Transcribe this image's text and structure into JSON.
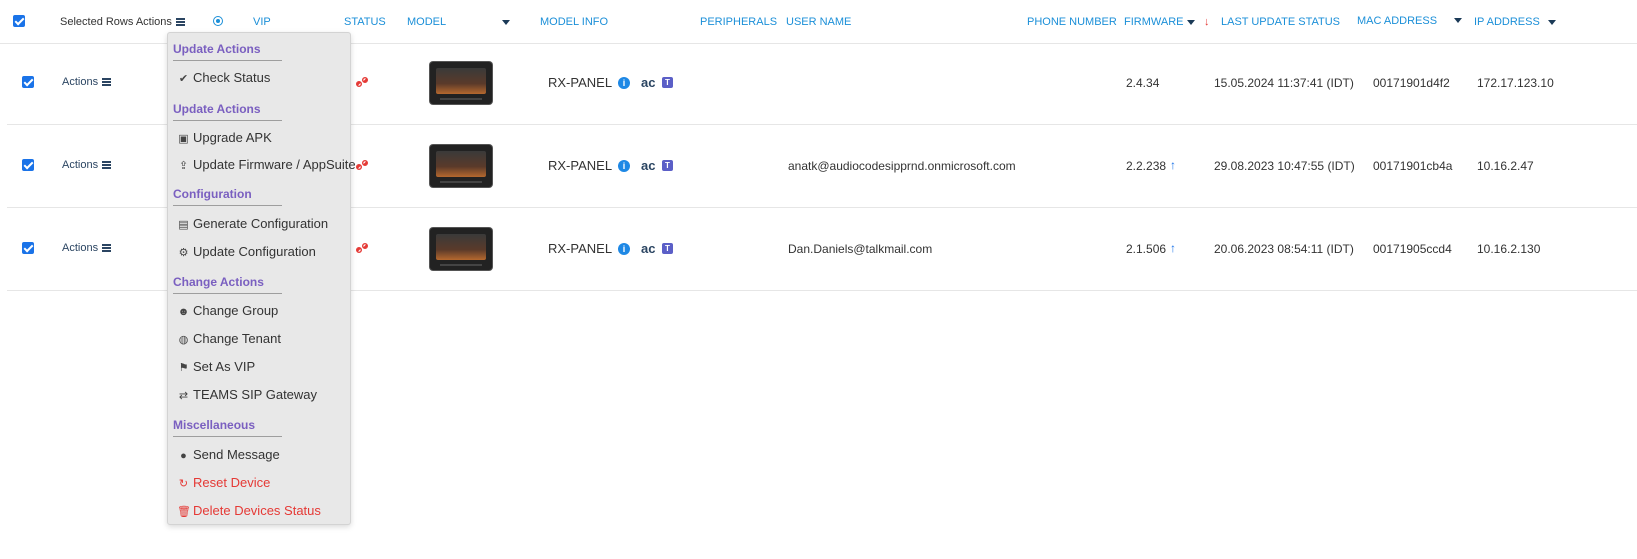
{
  "header": {
    "selected_rows_actions": "Selected Rows Actions",
    "vip": "VIP",
    "status": "STATUS",
    "model": "MODEL",
    "model_info": "MODEL INFO",
    "peripherals": "PERIPHERALS",
    "user_name": "USER NAME",
    "phone_number": "PHONE NUMBER",
    "firmware": "FIRMWARE",
    "last_update_status": "LAST UPDATE STATUS",
    "mac_address": "MAC ADDRESS",
    "ip_address": "IP ADDRESS",
    "sort_indicator": "↓"
  },
  "rows": [
    {
      "actions": "Actions",
      "model_info": "RX-PANEL",
      "user_name": "",
      "firmware": "2.4.34",
      "firmware_upgrade": false,
      "last_update": "15.05.2024 11:37:41 (IDT)",
      "mac": "00171901d4f2",
      "ip": "172.17.123.10"
    },
    {
      "actions": "Actions",
      "model_info": "RX-PANEL",
      "user_name": "anatk@audiocodesipprnd.onmicrosoft.com",
      "firmware": "2.2.238",
      "firmware_upgrade": true,
      "last_update": "29.08.2023 10:47:55 (IDT)",
      "mac": "00171901cb4a",
      "ip": "10.16.2.47"
    },
    {
      "actions": "Actions",
      "model_info": "RX-PANEL",
      "user_name": "Dan.Daniels@talkmail.com",
      "firmware": "2.1.506",
      "firmware_upgrade": true,
      "last_update": "20.06.2023 08:54:11 (IDT)",
      "mac": "00171905ccd4",
      "ip": "10.16.2.130"
    }
  ],
  "menu": {
    "sections": {
      "update_actions_1": "Update Actions",
      "update_actions_2": "Update Actions",
      "configuration": "Configuration",
      "change_actions": "Change Actions",
      "miscellaneous": "Miscellaneous"
    },
    "items": {
      "check_status": "Check Status",
      "upgrade_apk": "Upgrade APK",
      "update_firmware": "Update Firmware / AppSuite",
      "generate_configuration": "Generate Configuration",
      "update_configuration": "Update Configuration",
      "change_group": "Change Group",
      "change_tenant": "Change Tenant",
      "set_as_vip": "Set As VIP",
      "teams_sip_gateway": "TEAMS SIP Gateway",
      "send_message": "Send Message",
      "reset_device": "Reset Device",
      "delete_devices_status": "Delete Devices Status"
    }
  },
  "icons": {
    "checkbox": "checkbox-checked-icon",
    "menu": "hamburger-icon",
    "filter": "filter-icon",
    "status": "disconnected-link-icon",
    "info": "info-icon",
    "audiocodes": "audiocodes-icon",
    "teams": "teams-icon",
    "upgrade": "arrow-up-icon"
  },
  "colors": {
    "accent": "#1b8fd8",
    "checkbox": "#1a73e8",
    "menu_section": "#7a5fc0",
    "danger": "#e53935",
    "status_error": "#e53935"
  }
}
